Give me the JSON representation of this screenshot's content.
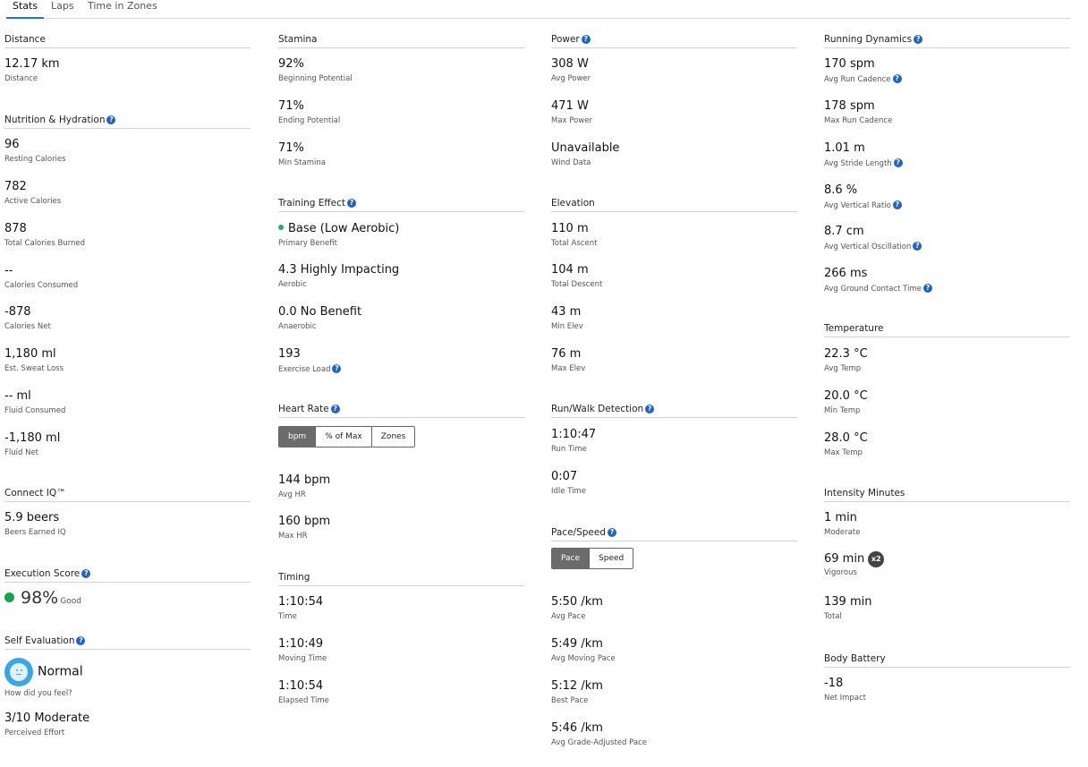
{
  "tabs": [
    "Stats",
    "Laps",
    "Time in Zones"
  ],
  "colors": {
    "accent": "#1976d2",
    "help": "#1e63c6",
    "good": "#17a34a",
    "benefit": "#2aa876",
    "segment_on": "#6b6b6b"
  },
  "distance": {
    "title": "Distance",
    "value": "12.17 km",
    "label": "Distance"
  },
  "nutrition": {
    "title": "Nutrition & Hydration",
    "stats": [
      {
        "value": "96",
        "label": "Resting Calories"
      },
      {
        "value": "782",
        "label": "Active Calories"
      },
      {
        "value": "878",
        "label": "Total Calories Burned"
      },
      {
        "value": "--",
        "label": "Calories Consumed"
      },
      {
        "value": "-878",
        "label": "Calories Net"
      },
      {
        "value": "1,180 ml",
        "label": "Est. Sweat Loss"
      },
      {
        "value": "-- ml",
        "label": "Fluid Consumed"
      },
      {
        "value": "-1,180 ml",
        "label": "Fluid Net"
      }
    ]
  },
  "connect_iq": {
    "title": "Connect IQ™",
    "value": "5.9 beers",
    "label": "Beers Earned  IQ"
  },
  "execution": {
    "title": "Execution Score",
    "value": "98%",
    "rating": "Good"
  },
  "self_eval": {
    "title": "Self Evaluation",
    "feel": "Normal",
    "feel_label": "How did you feel?",
    "effort": "3/10 Moderate",
    "effort_label": "Perceived Effort"
  },
  "stamina": {
    "title": "Stamina",
    "stats": [
      {
        "value": "92%",
        "label": "Beginning Potential"
      },
      {
        "value": "71%",
        "label": "Ending Potential"
      },
      {
        "value": "71%",
        "label": "Min Stamina"
      }
    ]
  },
  "training_effect": {
    "title": "Training Effect",
    "primary": {
      "value": "Base (Low Aerobic)",
      "label": "Primary Benefit"
    },
    "stats": [
      {
        "value": "4.3 Highly Impacting",
        "label": "Aerobic"
      },
      {
        "value": "0.0 No Benefit",
        "label": "Anaerobic"
      },
      {
        "value": "193",
        "label": "Exercise Load"
      }
    ]
  },
  "heart_rate": {
    "title": "Heart Rate",
    "toggle": [
      "bpm",
      "% of Max",
      "Zones"
    ],
    "stats": [
      {
        "value": "144 bpm",
        "label": "Avg HR"
      },
      {
        "value": "160 bpm",
        "label": "Max HR"
      }
    ]
  },
  "timing": {
    "title": "Timing",
    "stats": [
      {
        "value": "1:10:54",
        "label": "Time"
      },
      {
        "value": "1:10:49",
        "label": "Moving Time"
      },
      {
        "value": "1:10:54",
        "label": "Elapsed Time"
      }
    ]
  },
  "power": {
    "title": "Power",
    "stats": [
      {
        "value": "308 W",
        "label": "Avg Power"
      },
      {
        "value": "471 W",
        "label": "Max Power"
      },
      {
        "value": "Unavailable",
        "label": "Wind Data"
      }
    ]
  },
  "elevation": {
    "title": "Elevation",
    "stats": [
      {
        "value": "110 m",
        "label": "Total Ascent"
      },
      {
        "value": "104 m",
        "label": "Total Descent"
      },
      {
        "value": "43 m",
        "label": "Min Elev"
      },
      {
        "value": "76 m",
        "label": "Max Elev"
      }
    ]
  },
  "run_walk": {
    "title": "Run/Walk Detection",
    "stats": [
      {
        "value": "1:10:47",
        "label": "Run Time"
      },
      {
        "value": "0:07",
        "label": "Idle Time"
      }
    ]
  },
  "pace": {
    "title": "Pace/Speed",
    "toggle": [
      "Pace",
      "Speed"
    ],
    "stats": [
      {
        "value": "5:50 /km",
        "label": "Avg Pace"
      },
      {
        "value": "5:49 /km",
        "label": "Avg Moving Pace"
      },
      {
        "value": "5:12 /km",
        "label": "Best Pace"
      },
      {
        "value": "5:46 /km",
        "label": "Avg Grade-Adjusted Pace"
      }
    ]
  },
  "running_dynamics": {
    "title": "Running Dynamics",
    "stats": [
      {
        "value": "170 spm",
        "label": "Avg Run Cadence"
      },
      {
        "value": "178 spm",
        "label": "Max Run Cadence"
      },
      {
        "value": "1.01 m",
        "label": "Avg Stride Length"
      },
      {
        "value": "8.6 %",
        "label": "Avg Vertical Ratio"
      },
      {
        "value": "8.7 cm",
        "label": "Avg Vertical Oscillation"
      },
      {
        "value": "266 ms",
        "label": "Avg Ground Contact Time"
      }
    ]
  },
  "temperature": {
    "title": "Temperature",
    "stats": [
      {
        "value": "22.3 °C",
        "label": "Avg Temp"
      },
      {
        "value": "20.0 °C",
        "label": "Min Temp"
      },
      {
        "value": "28.0 °C",
        "label": "Max Temp"
      }
    ]
  },
  "intensity": {
    "title": "Intensity Minutes",
    "multiplier": "x2",
    "stats": [
      {
        "value": "1 min",
        "label": "Moderate"
      },
      {
        "value": "69 min",
        "label": "Vigorous"
      },
      {
        "value": "139 min",
        "label": "Total"
      }
    ]
  },
  "body_battery": {
    "title": "Body Battery",
    "value": "-18",
    "label": "Net Impact"
  }
}
